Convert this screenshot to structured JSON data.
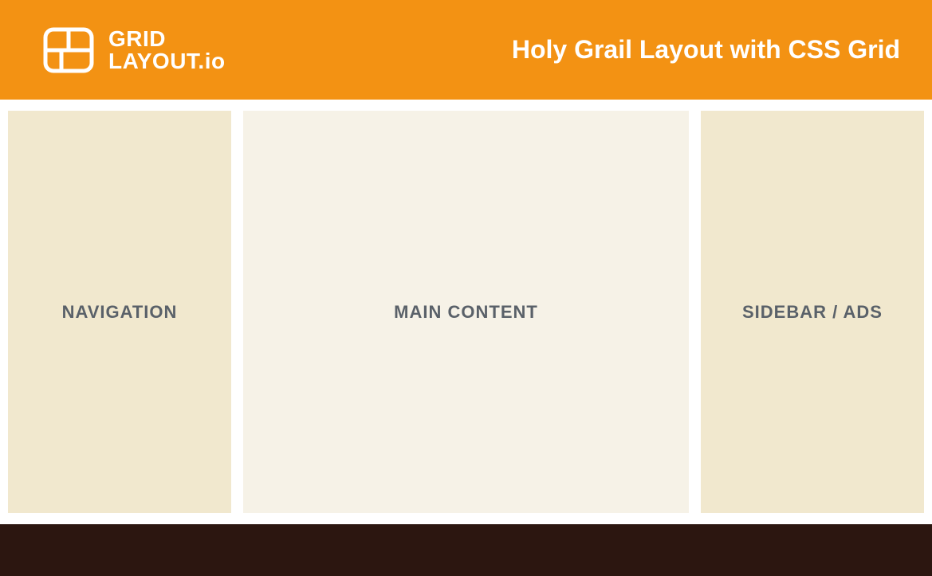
{
  "header": {
    "brand_line1": "GRID",
    "brand_line2": "LAYOUT.io",
    "title": "Holy Grail Layout with CSS Grid"
  },
  "columns": {
    "left_label": "NAVIGATION",
    "center_label": "MAIN CONTENT",
    "right_label": "SIDEBAR / ADS"
  },
  "colors": {
    "header_bg": "#f39213",
    "panel_bg": "#f1e8ce",
    "panel_center_bg": "#f6f2e7",
    "footer_bg": "#2c1610",
    "panel_text": "#5a6169"
  }
}
